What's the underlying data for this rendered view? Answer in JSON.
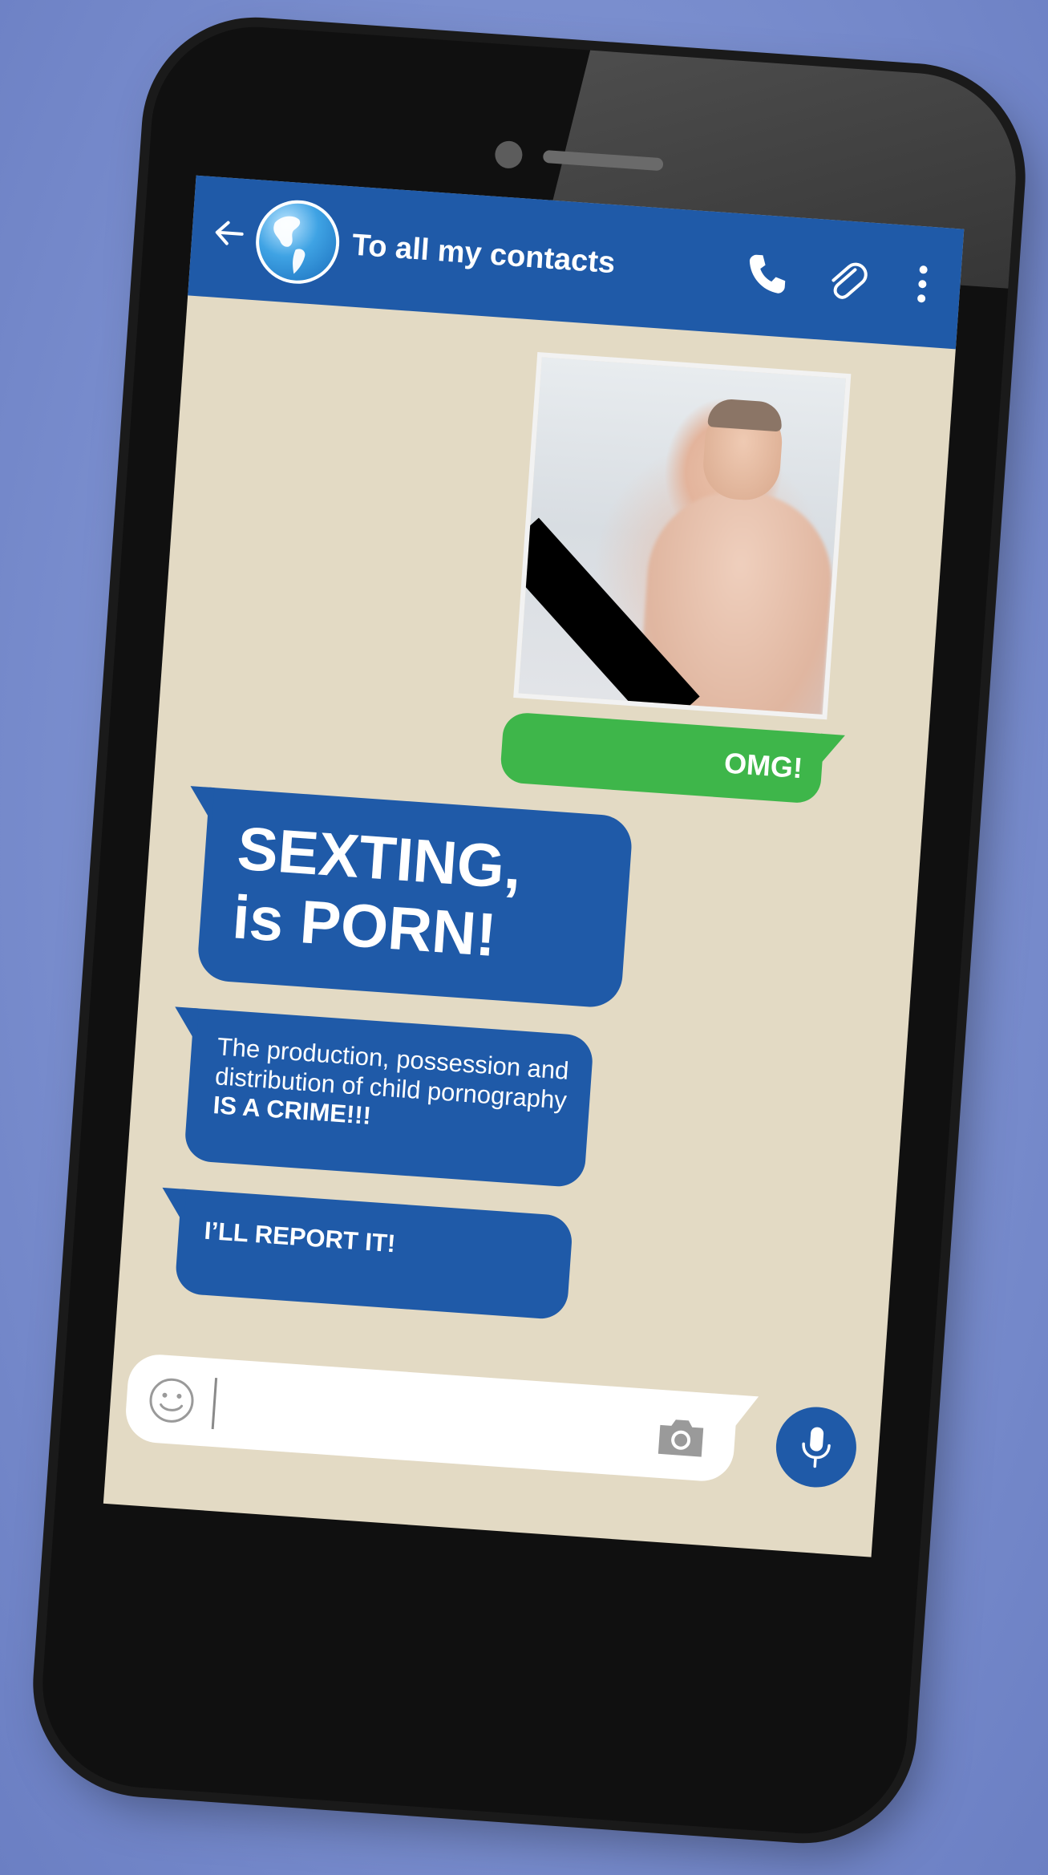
{
  "header": {
    "title": "To all my contacts",
    "back_icon": "arrow-left-icon",
    "avatar_icon": "globe-icon",
    "actions": [
      "phone-icon",
      "paperclip-icon",
      "kebab-menu-icon"
    ]
  },
  "messages": {
    "sent_reply": "OMG!",
    "received_headline_line1": "SEXTING,",
    "received_headline_line2": "is PORN!",
    "received_info_text": "The production, possession and distribution of child pornography",
    "received_info_strong": "IS A CRIME!!!",
    "received_report": "I’LL REPORT IT!"
  },
  "composer": {
    "value": "",
    "emoji_icon": "smiley-icon",
    "attach_icon": "camera-icon",
    "send_icon": "microphone-icon"
  },
  "colors": {
    "header_blue": "#1f5aa8",
    "sent_green": "#3eb64a",
    "chat_background": "#e3dac4",
    "page_background": "#7b8fcf"
  }
}
